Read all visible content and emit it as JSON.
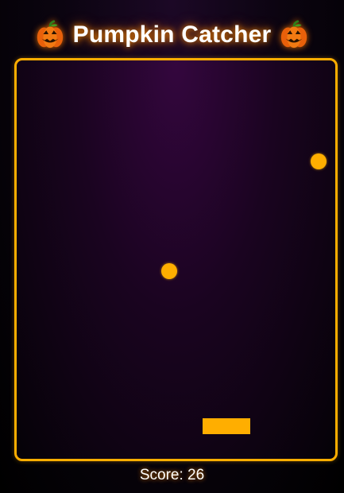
{
  "header": {
    "title": "Pumpkin Catcher",
    "left_icon": "jack-o-lantern",
    "right_icon": "jack-o-lantern"
  },
  "game": {
    "falling_object": "orange-circle",
    "player_object": "orange-bar",
    "accent_color": "#ffae00"
  },
  "status": {
    "score_text": "Score: 26"
  }
}
